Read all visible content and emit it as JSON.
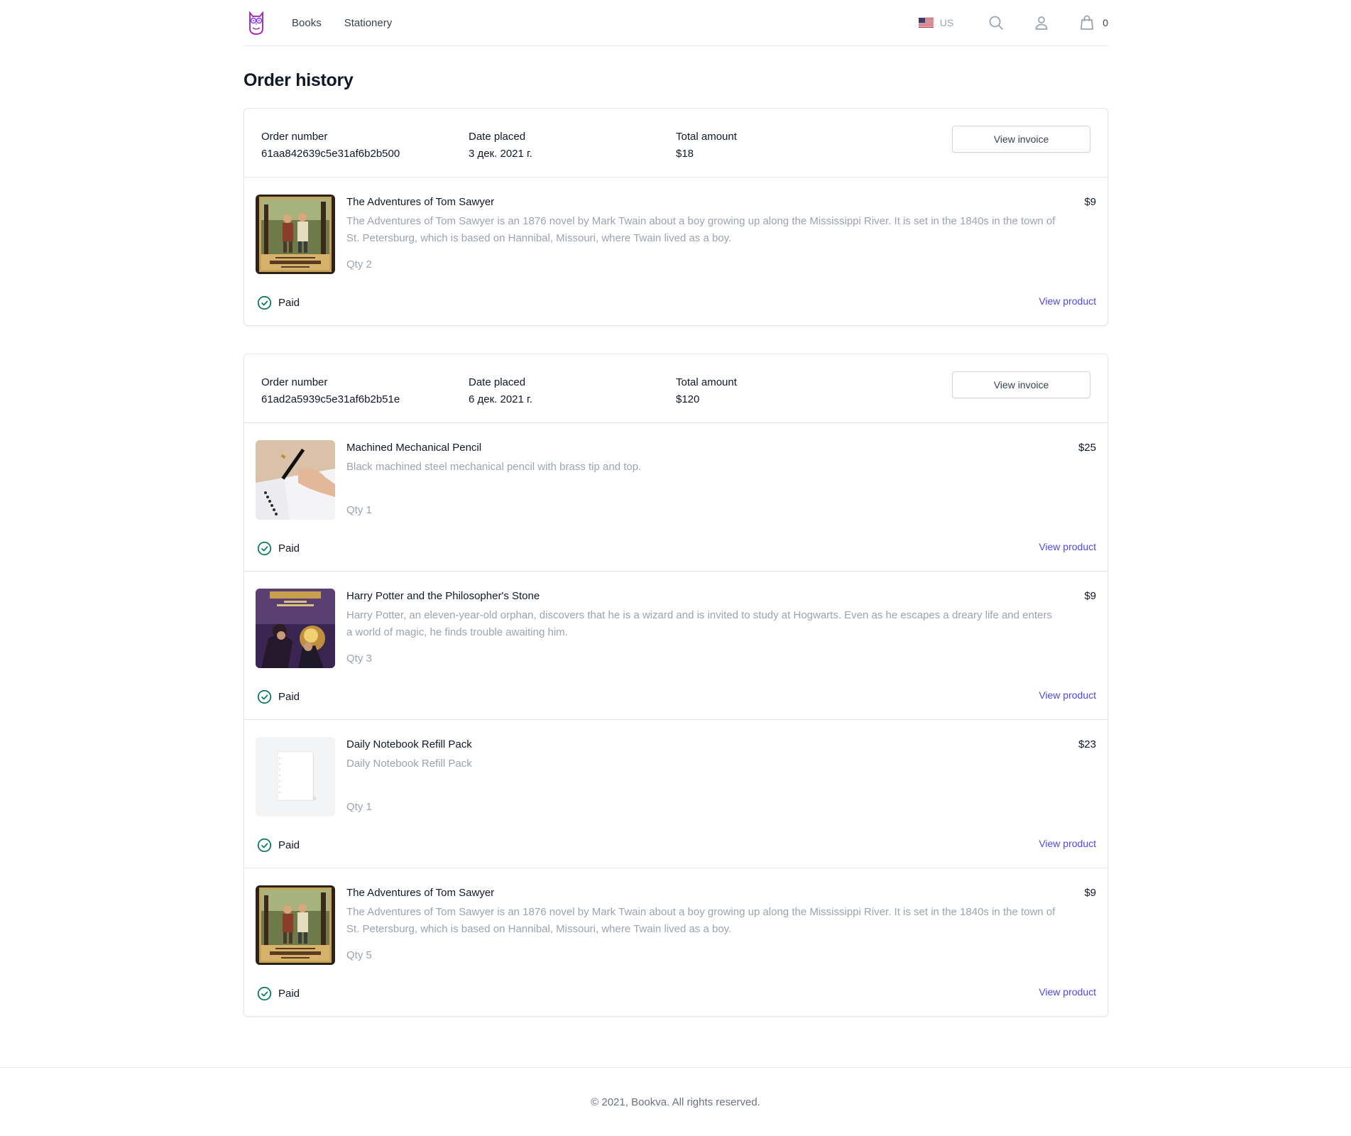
{
  "nav": {
    "books": "Books",
    "stationery": "Stationery"
  },
  "header": {
    "locale": "US",
    "cart_count": "0",
    "icons": [
      "owl-logo",
      "us-flag-icon",
      "search-icon",
      "user-icon",
      "shopping-bag-icon"
    ]
  },
  "page": {
    "title": "Order history"
  },
  "labels": {
    "order_number": "Order number",
    "date_placed": "Date placed",
    "total_amount": "Total amount",
    "view_invoice": "View invoice",
    "paid": "Paid",
    "view_product": "View product"
  },
  "orders": [
    {
      "number": "61aa842639c5e31af6b2b500",
      "date": "3 дек. 2021 г.",
      "total": "$18",
      "items": [
        {
          "name": "The Adventures of Tom Sawyer",
          "price": "$9",
          "description": "The Adventures of Tom Sawyer is an 1876 novel by Mark Twain about a boy growing up along the Mississippi River. It is set in the 1840s in the town of St. Petersburg, which is based on Hannibal, Missouri, where Twain lived as a boy.",
          "qty": "Qty 2",
          "status": "Paid",
          "thumb": "tom-sawyer-cover"
        }
      ]
    },
    {
      "number": "61ad2a5939c5e31af6b2b51e",
      "date": "6 дек. 2021 г.",
      "total": "$120",
      "items": [
        {
          "name": "Machined Mechanical Pencil",
          "price": "$25",
          "description": "Black machined steel mechanical pencil with brass tip and top.",
          "qty": "Qty 1",
          "status": "Paid",
          "thumb": "pencil-photo"
        },
        {
          "name": "Harry Potter and the Philosopher's Stone",
          "price": "$9",
          "description": "Harry Potter, an eleven-year-old orphan, discovers that he is a wizard and is invited to study at Hogwarts. Even as he escapes a dreary life and enters a world of magic, he finds trouble awaiting him.",
          "qty": "Qty 3",
          "status": "Paid",
          "thumb": "harry-potter-cover"
        },
        {
          "name": "Daily Notebook Refill Pack",
          "price": "$23",
          "description": "Daily Notebook Refill Pack",
          "qty": "Qty 1",
          "status": "Paid",
          "thumb": "notebook-photo"
        },
        {
          "name": "The Adventures of Tom Sawyer",
          "price": "$9",
          "description": "The Adventures of Tom Sawyer is an 1876 novel by Mark Twain about a boy growing up along the Mississippi River. It is set in the 1840s in the town of St. Petersburg, which is based on Hannibal, Missouri, where Twain lived as a boy.",
          "qty": "Qty 5",
          "status": "Paid",
          "thumb": "tom-sawyer-cover"
        }
      ]
    }
  ],
  "footer": {
    "copyright": "© 2021, Bookva. All rights reserved."
  },
  "colors": {
    "accent": "#4f46e5",
    "paid": "#047857",
    "muted": "#9ca3af",
    "border": "#e5e7eb"
  }
}
